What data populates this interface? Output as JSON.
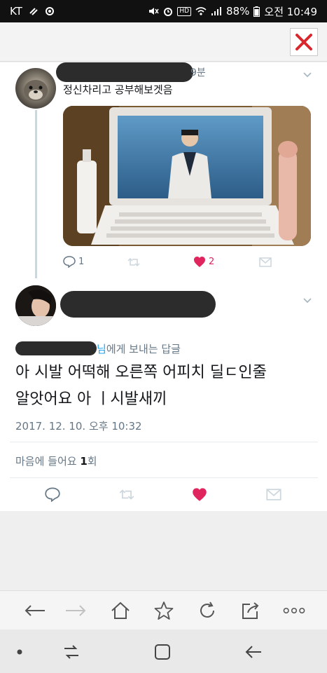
{
  "status_bar": {
    "carrier": "KT",
    "battery": "88%",
    "time": "오전 10:49",
    "hd_badge": "HD"
  },
  "tweet1": {
    "time": "9분",
    "text": "정신차리고 공부해보겟음",
    "reply_count": "1",
    "like_count": "2"
  },
  "tweet2": {
    "reply_to_suffix": "에게 보내는 답글",
    "reply_to_nim": "님",
    "text_line1": "아 시발 어떡해 오른쪽 어피치 딜ㄷ인줄",
    "text_line2": "알앗어요 아 ㅣ시발새끼",
    "timestamp": "2017. 12. 10. 오후 10:32",
    "likes_label": "마음에 들어요",
    "likes_count": "1",
    "likes_unit": "회"
  },
  "colors": {
    "like_red": "#e0245e",
    "icon_gray": "#aab8c2",
    "close_red": "#d9272e",
    "link_blue": "#1da1f2"
  }
}
